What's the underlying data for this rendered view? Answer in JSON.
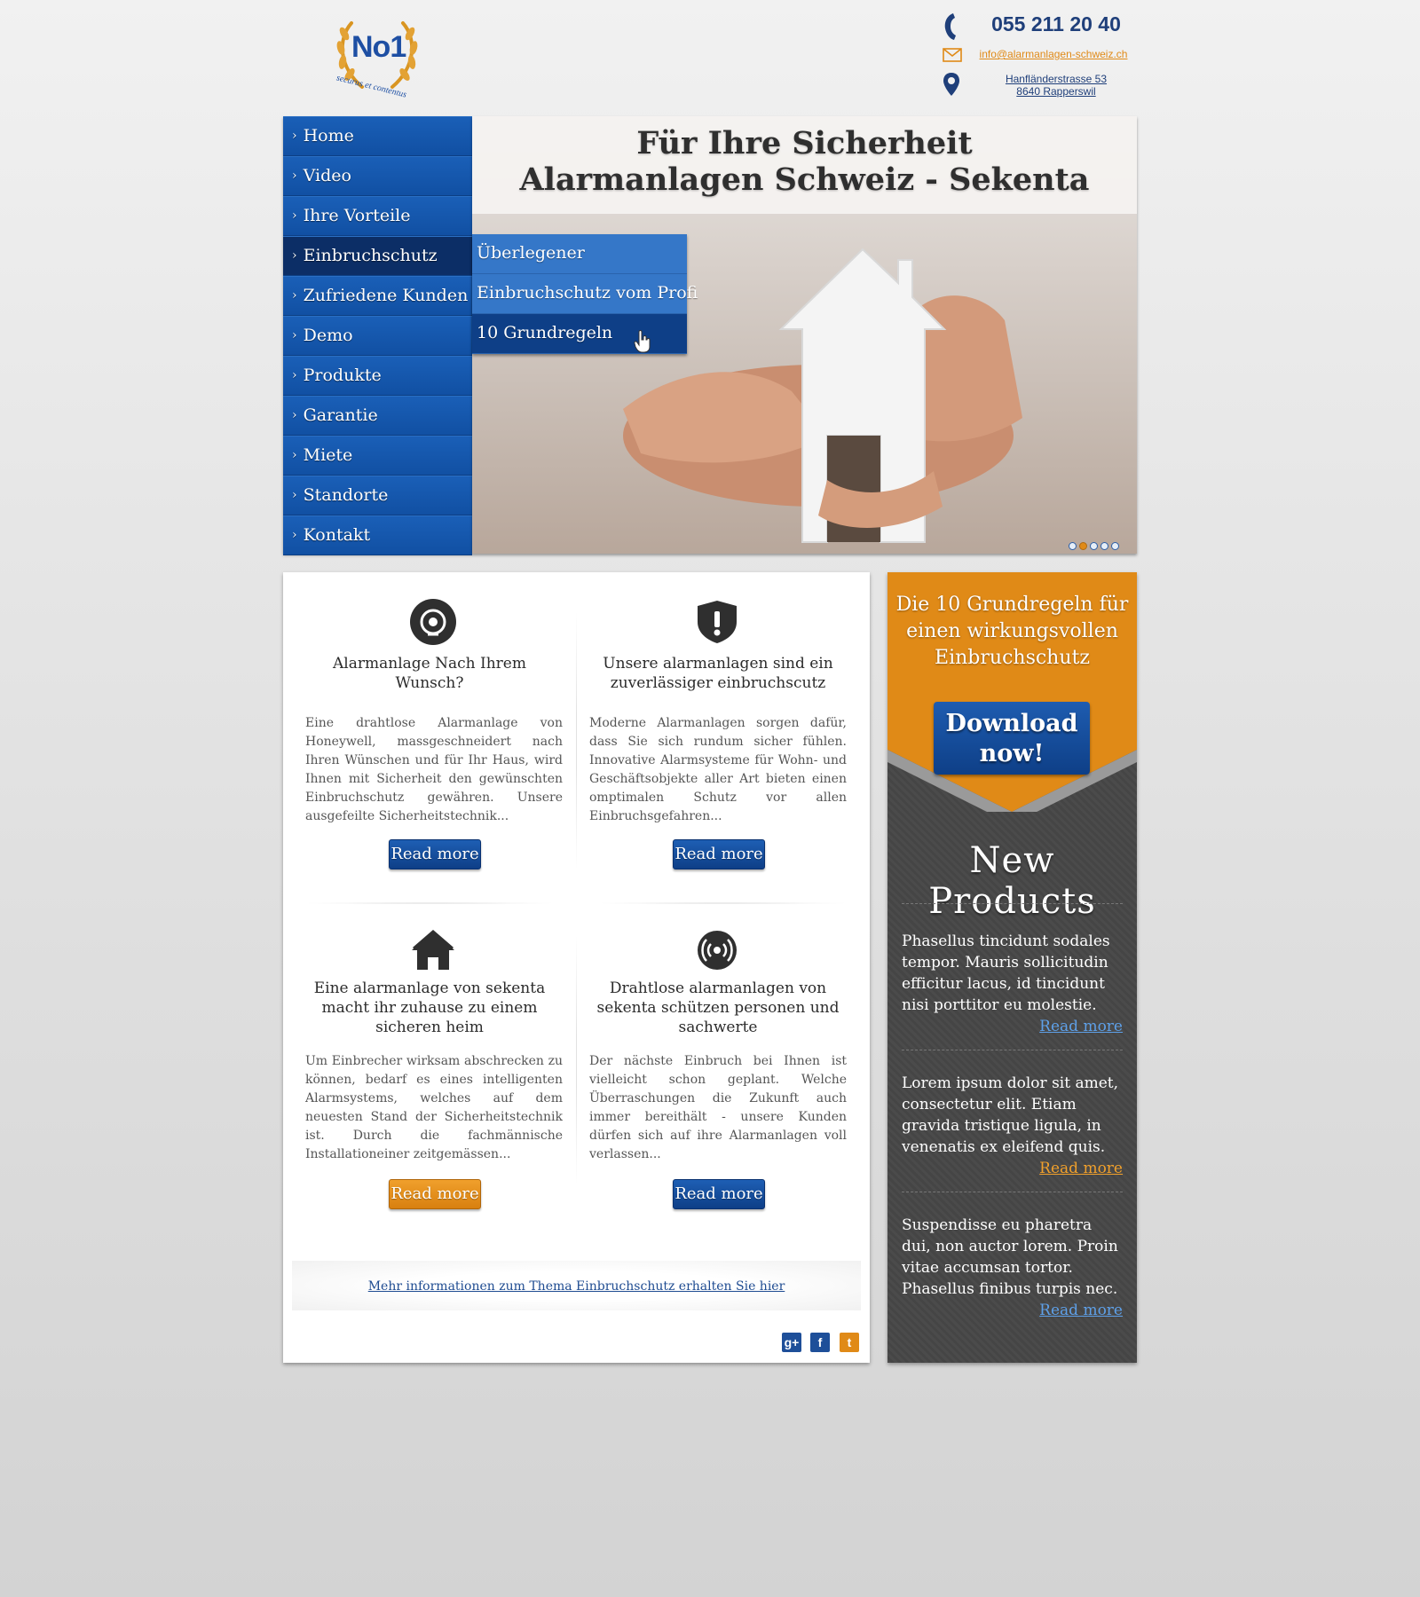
{
  "brand": {
    "logo_text": "No1",
    "logo_motto": "securus et contentus"
  },
  "contact": {
    "phone": "055 211 20 40",
    "email": "info@alarmanlagen-schweiz.ch",
    "address_line1": "Hanfländerstrasse 53",
    "address_line2": "8640 Rapperswil",
    "phone_icon": "phone-icon",
    "email_icon": "envelope-icon",
    "address_icon": "map-pin-icon"
  },
  "nav": {
    "items": [
      {
        "label": "Home"
      },
      {
        "label": "Video"
      },
      {
        "label": "Ihre Vorteile"
      },
      {
        "label": "Einbruchschutz"
      },
      {
        "label": "Zufriedene Kunden"
      },
      {
        "label": "Demo"
      },
      {
        "label": "Produkte"
      },
      {
        "label": "Garantie"
      },
      {
        "label": "Miete"
      },
      {
        "label": "Standorte"
      },
      {
        "label": "Kontakt"
      }
    ],
    "active": "Einbruchschutz",
    "chevron": "›",
    "submenu": [
      {
        "label": "Überlegener"
      },
      {
        "label": "Einbruchschutz vom Profi"
      },
      {
        "label": "10 Grundregeln"
      }
    ]
  },
  "hero": {
    "title_line1": "Für Ihre Sicherheit",
    "title_line2": "Alarmanlagen Schweiz - Sekenta",
    "slide_count": 5,
    "active_slide": 2
  },
  "cards": [
    {
      "icon": "alarm-siren-icon",
      "title": "Alarmanlage Nach Ihrem Wunsch?",
      "text": "Eine drahtlose Alarmanlage von Honeywell, massgeschneidert nach Ihren Wünschen und für Ihr Haus, wird Ihnen mit Sicherheit den gewünschten Einbruchschutz gewähren. Unsere ausgefeilte Sicherheitstechnik...",
      "button": "Read more",
      "button_style": "blue"
    },
    {
      "icon": "shield-warning-icon",
      "title": "Unsere alarmanlagen sind ein zuverlässiger einbruchscutz",
      "text": "Moderne Alarmanlagen sorgen dafür, dass Sie sich rundum sicher fühlen. Innovative Alarmsysteme für Wohn- und Geschäftsobjekte aller Art bieten einen omptimalen Schutz vor allen Einbruchsgefahren...",
      "button": "Read more",
      "button_style": "blue"
    },
    {
      "icon": "house-icon",
      "title": "Eine alarmanlage von sekenta macht ihr zuhause zu einem sicheren heim",
      "text": "Um Einbrecher wirksam abschrecken zu können, bedarf es eines intelligenten Alarmsystems, welches auf dem neuesten Stand der Sicherheitstechnik ist. Durch die fachmännische Installationeiner zeitgemässen...",
      "button": "Read more",
      "button_style": "orange"
    },
    {
      "icon": "wireless-signal-icon",
      "title": "Drahtlose alarmanlagen von sekenta schützen personen und sachwerte",
      "text": "Der nächste Einbruch bei Ihnen ist vielleicht schon geplant. Welche Überraschungen die Zukunft auch immer bereithält - unsere Kunden dürfen sich auf ihre Alarmanlagen voll verlassen...",
      "button": "Read more",
      "button_style": "blue"
    }
  ],
  "info_link": "Mehr informationen zum Thema Einbruchschutz erhalten Sie hier",
  "social": [
    {
      "icon": "google-plus-icon",
      "label": "g+",
      "color": "#1e4f99"
    },
    {
      "icon": "facebook-icon",
      "label": "f",
      "color": "#1e4f99"
    },
    {
      "icon": "twitter-icon",
      "label": "t",
      "color": "#e08a17"
    }
  ],
  "sidebar": {
    "promo_title": "Die 10 Grundregeln für einen wirkungsvollen Einbruchschutz",
    "download_button": "Download now!",
    "products_title": "New Products",
    "products": [
      {
        "text": "Phasellus tincidunt sodales tempor. Mauris sollicitudin efficitur lacus, id tincidunt nisi porttitor eu molestie.",
        "link": "Read more",
        "link_color": "#5ea0e8"
      },
      {
        "text": "Lorem ipsum dolor sit amet, consectetur elit. Etiam gravida tristique ligula, in venenatis ex eleifend quis.",
        "link": "Read more",
        "link_color": "#f0a02c"
      },
      {
        "text": "Suspendisse eu pharetra dui, non auctor lorem. Proin vitae accumsan tortor. Phasellus finibus turpis nec.",
        "link": "Read more",
        "link_color": "#5ea0e8"
      }
    ]
  },
  "colors": {
    "brand_blue": "#1458b0",
    "dark_blue": "#0c2e66",
    "accent_orange": "#e08a17",
    "sidebar_dark": "#4b4b4b"
  }
}
